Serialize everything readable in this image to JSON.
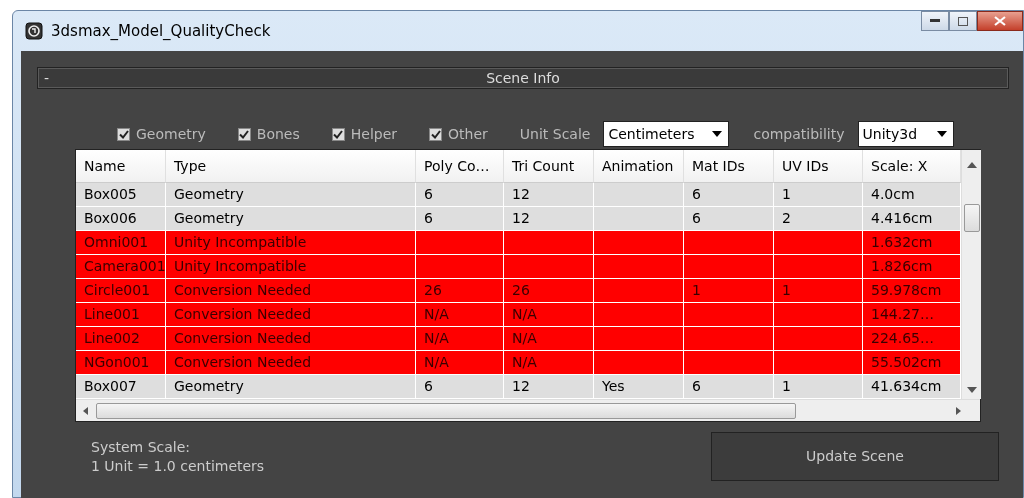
{
  "window": {
    "title": "3dsmax_Model_QualityCheck"
  },
  "rollout": {
    "collapse_label": "-",
    "title": "Scene Info"
  },
  "filters": [
    {
      "label": "Geometry",
      "checked": true
    },
    {
      "label": "Bones",
      "checked": true
    },
    {
      "label": "Helper",
      "checked": true
    },
    {
      "label": "Other",
      "checked": true
    }
  ],
  "unit_scale": {
    "label": "Unit Scale",
    "value": "Centimeters"
  },
  "compatibility": {
    "label": "compatibility",
    "value": "Unity3d"
  },
  "table": {
    "columns": [
      "Name",
      "Type",
      "Poly Co…",
      "Tri Count",
      "Animation",
      "Mat IDs",
      "UV IDs",
      "Scale: X"
    ],
    "rows": [
      {
        "flagged": false,
        "cells": [
          "Box005",
          "Geometry",
          "6",
          "12",
          "",
          "6",
          "1",
          "4.0cm"
        ]
      },
      {
        "flagged": false,
        "cells": [
          "Box006",
          "Geometry",
          "6",
          "12",
          "",
          "6",
          "2",
          "4.416cm"
        ]
      },
      {
        "flagged": true,
        "cells": [
          "Omni001",
          "Unity Incompatible",
          "",
          "",
          "",
          "",
          "",
          "1.632cm"
        ]
      },
      {
        "flagged": true,
        "cells": [
          "Camera001",
          "Unity Incompatible",
          "",
          "",
          "",
          "",
          "",
          "1.826cm"
        ]
      },
      {
        "flagged": true,
        "cells": [
          "Circle001",
          "Conversion Needed",
          "26",
          "26",
          "",
          "1",
          "1",
          "59.978cm"
        ]
      },
      {
        "flagged": true,
        "cells": [
          "Line001",
          "Conversion Needed",
          "N/A",
          "N/A",
          "",
          "",
          "",
          "144.27…"
        ]
      },
      {
        "flagged": true,
        "cells": [
          "Line002",
          "Conversion Needed",
          "N/A",
          "N/A",
          "",
          "",
          "",
          "224.65…"
        ]
      },
      {
        "flagged": true,
        "cells": [
          "NGon001",
          "Conversion Needed",
          "N/A",
          "N/A",
          "",
          "",
          "",
          "55.502cm"
        ]
      },
      {
        "flagged": false,
        "cells": [
          "Box007",
          "Geometry",
          "6",
          "12",
          "Yes",
          "6",
          "1",
          "41.634cm"
        ]
      }
    ]
  },
  "system_scale": {
    "label": "System Scale:",
    "value": "1 Unit = 1.0 centimeters"
  },
  "update_button": "Update Scene"
}
